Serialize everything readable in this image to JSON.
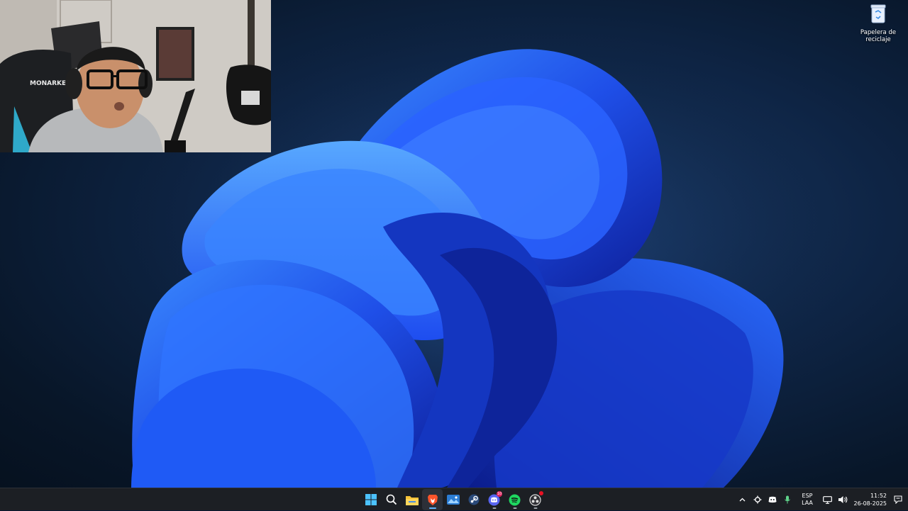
{
  "desktop": {
    "icons": [
      {
        "label": "Papelera de\nreciclaje",
        "icon": "recycle-bin-icon"
      }
    ]
  },
  "webcam": {
    "chair_brand": "MONARKEY"
  },
  "taskbar": {
    "pinned": [
      {
        "name": "start",
        "icon": "windows-start-icon",
        "running": false
      },
      {
        "name": "search",
        "icon": "search-icon",
        "running": false
      },
      {
        "name": "file-explorer",
        "icon": "folder-icon",
        "running": false
      },
      {
        "name": "brave",
        "icon": "brave-browser-icon",
        "running": true,
        "active": true
      },
      {
        "name": "photos",
        "icon": "photos-icon",
        "running": false
      },
      {
        "name": "steam",
        "icon": "steam-icon",
        "running": false
      },
      {
        "name": "discord",
        "icon": "discord-icon",
        "running": true,
        "badge": "10"
      },
      {
        "name": "spotify",
        "icon": "spotify-icon",
        "running": true
      },
      {
        "name": "obs",
        "icon": "obs-icon",
        "running": true,
        "badge_dot": true
      }
    ],
    "tray": {
      "chevron_icon": "chevron-up-icon",
      "icons": [
        "gear-tray-icon",
        "discord-tray-icon",
        "microphone-icon"
      ],
      "language": {
        "line1": "ESP",
        "line2": "LAA"
      },
      "network_icon": "network-icon",
      "volume_icon": "volume-icon",
      "time": "11:52",
      "date": "26-08-2025",
      "notification_icon": "notification-icon"
    }
  },
  "colors": {
    "taskbar_bg": "#1c1f24",
    "accent": "#60b4ff",
    "wallpaper_blue": "#1e5cff"
  }
}
